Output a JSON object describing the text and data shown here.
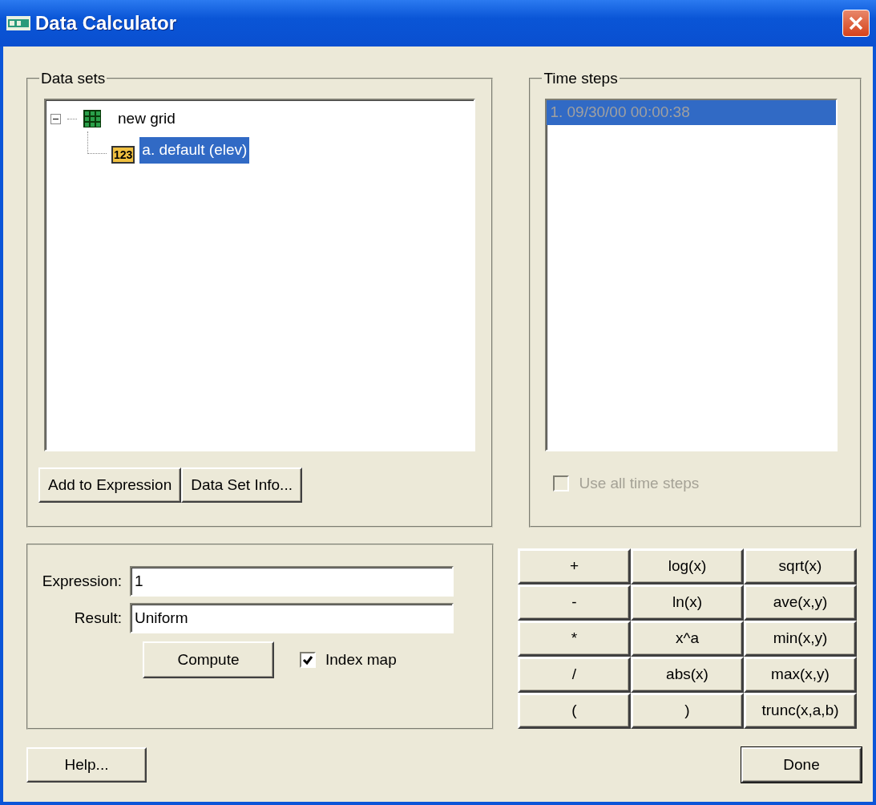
{
  "window": {
    "title": "Data Calculator"
  },
  "data_sets": {
    "label": "Data sets",
    "tree": [
      {
        "label": "new grid",
        "kind": "grid",
        "expanded": true,
        "selected": false,
        "children": [
          {
            "label": "a. default (elev)",
            "kind": "scalar",
            "icon_text": "123",
            "selected": true
          }
        ]
      }
    ],
    "buttons": [
      "Add to Expression",
      "Data Set Info..."
    ]
  },
  "time_steps": {
    "label": "Time steps",
    "disabled": true,
    "items": [
      {
        "label": "1. 09/30/00 00:00:38",
        "selected": true
      }
    ],
    "use_all": {
      "label": "Use all time steps",
      "checked": false,
      "disabled": true
    }
  },
  "expression": {
    "label": "Expression:",
    "value": "1"
  },
  "result": {
    "label": "Result:",
    "value": "Uniform"
  },
  "compute_button": "Compute",
  "index_map": {
    "label": "Index map",
    "checked": true
  },
  "operators": [
    "+",
    "log(x)",
    "sqrt(x)",
    "-",
    "ln(x)",
    "ave(x,y)",
    "*",
    "x^a",
    "min(x,y)",
    "/",
    "abs(x)",
    "max(x,y)",
    "(",
    ")",
    "trunc(x,a,b)"
  ],
  "help_button": "Help...",
  "done_button": "Done"
}
